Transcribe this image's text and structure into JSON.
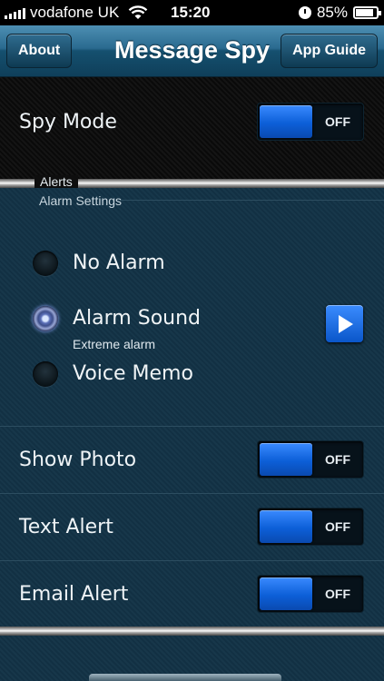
{
  "status_bar": {
    "carrier": "vodafone UK",
    "time": "15:20",
    "battery_percent": "85%",
    "battery_level": 0.85
  },
  "nav": {
    "title": "Message Spy",
    "left_button": "About",
    "right_button": "App Guide"
  },
  "spy_mode": {
    "label": "Spy Mode",
    "toggle_text": "OFF"
  },
  "alerts": {
    "group_title": "Alerts",
    "alarm_settings_label": "Alarm Settings",
    "options": [
      {
        "label": "No Alarm",
        "selected": false
      },
      {
        "label": "Alarm Sound",
        "selected": true,
        "subtitle": "Extreme alarm"
      },
      {
        "label": "Voice Memo",
        "selected": false
      }
    ]
  },
  "settings": [
    {
      "label": "Show Photo",
      "toggle_text": "OFF"
    },
    {
      "label": "Text Alert",
      "toggle_text": "OFF"
    },
    {
      "label": "Email Alert",
      "toggle_text": "OFF"
    }
  ],
  "colors": {
    "toggle_blue": "#0c5fd8",
    "nav_blue": "#2a6a8f"
  }
}
